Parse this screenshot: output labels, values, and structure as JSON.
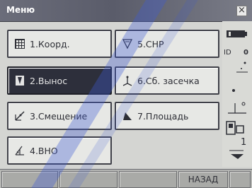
{
  "window": {
    "title": "Меню",
    "close_glyph": "×"
  },
  "menu_items": [
    {
      "label": "1.Коорд.",
      "icon": "grid-icon",
      "selected": false
    },
    {
      "label": "2.Вынос",
      "icon": "stakeout-icon",
      "selected": true
    },
    {
      "label": "3.Смещение",
      "icon": "offset-icon",
      "selected": false
    },
    {
      "label": "4.ВНО",
      "icon": "rem-icon",
      "selected": false
    },
    {
      "label": "5.СНР",
      "icon": "triangle-icon",
      "selected": false
    },
    {
      "label": "6.Сб. засечка",
      "icon": "resection-icon",
      "selected": false
    },
    {
      "label": "7.Площадь",
      "icon": "area-icon",
      "selected": false
    }
  ],
  "status_panel": {
    "battery": "battery-icon",
    "mode_left": "ID",
    "mode_right": "0",
    "tilt": "tilt-icon",
    "target": "target-icon",
    "prism": "prism-icon",
    "page_indicator": "1",
    "page_icon": "page-icon"
  },
  "function_keys": [
    "",
    "",
    "",
    "НАЗАД"
  ],
  "colors": {
    "accent": "#2d2f3b",
    "watermark": "#3f5bd3"
  }
}
